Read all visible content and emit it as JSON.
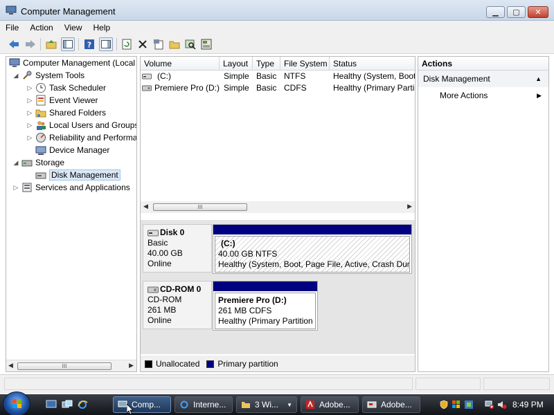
{
  "window": {
    "title": "Computer Management"
  },
  "menu": [
    "File",
    "Action",
    "View",
    "Help"
  ],
  "tree": {
    "root": "Computer Management (Local",
    "system_tools": "System Tools",
    "system_tools_children": [
      "Task Scheduler",
      "Event Viewer",
      "Shared Folders",
      "Local Users and Groups",
      "Reliability and Performa",
      "Device Manager"
    ],
    "storage": "Storage",
    "disk_management": "Disk Management",
    "services": "Services and Applications",
    "scroll_thumb": "III"
  },
  "volume_list": {
    "columns": [
      "Volume",
      "Layout",
      "Type",
      "File System",
      "Status"
    ],
    "rows": [
      {
        "volume": "(C:)",
        "layout": "Simple",
        "type": "Basic",
        "fs": "NTFS",
        "status": "Healthy (System, Boot"
      },
      {
        "volume": "Premiere Pro (D:)",
        "layout": "Simple",
        "type": "Basic",
        "fs": "CDFS",
        "status": "Healthy (Primary Parti"
      }
    ],
    "scroll_thumb": "III"
  },
  "disks": [
    {
      "name": "Disk 0",
      "kind": "Basic",
      "size": "40.00 GB",
      "state": "Online",
      "volume": {
        "title": "(C:)",
        "detail": "40.00 GB NTFS",
        "status": "Healthy (System, Boot, Page File, Active, Crash Dum"
      }
    },
    {
      "name": "CD-ROM 0",
      "kind": "CD-ROM",
      "size": "261 MB",
      "state": "Online",
      "volume": {
        "title": "Premiere Pro  (D:)",
        "detail": "261 MB CDFS",
        "status": "Healthy (Primary Partition"
      }
    }
  ],
  "legend": [
    {
      "label": "Unallocated",
      "color": "#000000"
    },
    {
      "label": "Primary partition",
      "color": "#000080"
    }
  ],
  "actions": {
    "header": "Actions",
    "group": "Disk Management",
    "items": [
      "More Actions"
    ]
  },
  "taskbar": {
    "tasks": [
      "Comp...",
      "Interne...",
      "3 Wi...",
      "Adobe...",
      "Adobe..."
    ],
    "clock": "8:49 PM"
  },
  "colors": {
    "primary_partition": "#000080",
    "selection": "#dbe8f6"
  }
}
